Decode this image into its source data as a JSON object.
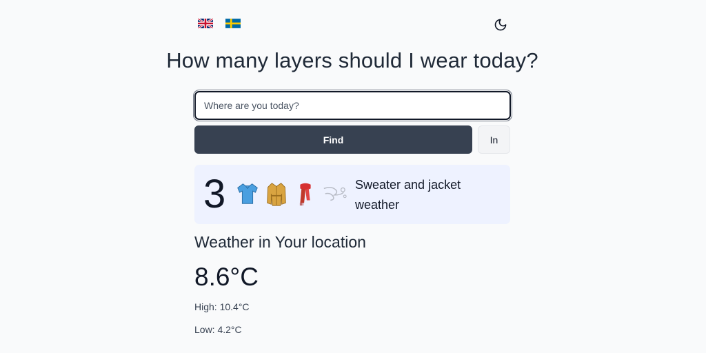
{
  "header": {
    "languages": [
      {
        "code": "en",
        "flag_icon": "uk-flag-icon"
      },
      {
        "code": "sv",
        "flag_icon": "sweden-flag-icon"
      }
    ],
    "theme_toggle_icon": "moon-icon"
  },
  "title": "How many layers should I wear today?",
  "search": {
    "placeholder": "Where are you today?",
    "value": ""
  },
  "buttons": {
    "find_label": "Find",
    "unit_label": "In"
  },
  "layers": {
    "count": "3",
    "icons": [
      "shirt-icon",
      "coat-icon",
      "scarf-icon",
      "wind-icon"
    ],
    "description": "Sweater and jacket weather"
  },
  "weather": {
    "location_title": "Weather in Your location",
    "temperature": "8.6°C",
    "high": "High: 10.4°C",
    "low": "Low: 4.2°C"
  },
  "colors": {
    "primary_button": "#374151",
    "card_background": "#eef2ff",
    "page_background": "#f9fafb"
  }
}
